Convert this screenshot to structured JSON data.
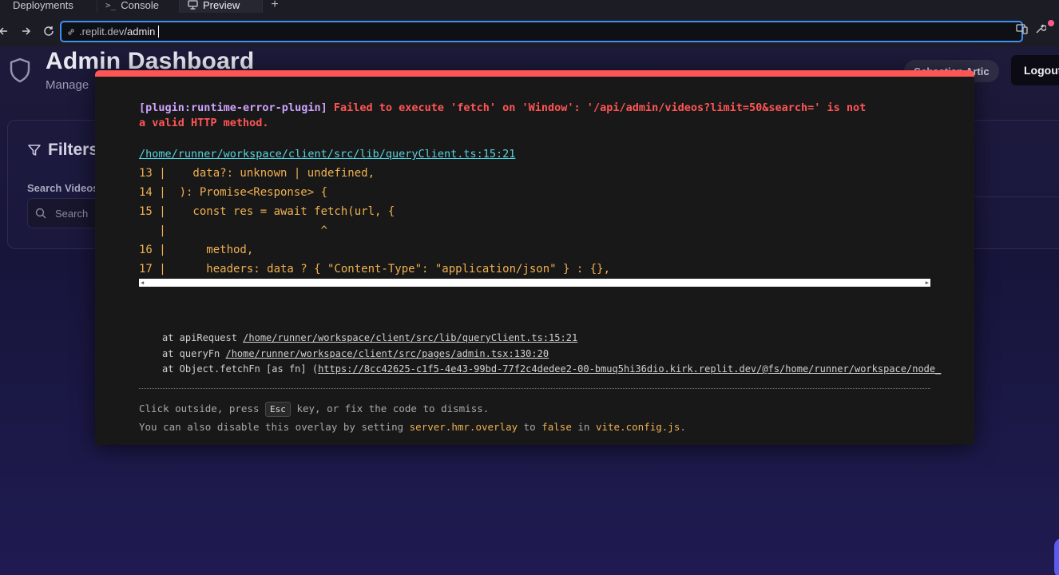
{
  "tabs": [
    {
      "label": "Deployments",
      "icon": "rocket-icon"
    },
    {
      "label": "Console",
      "icon_glyph": ">_"
    },
    {
      "label": "Preview",
      "icon": "monitor-icon"
    }
  ],
  "tab_add_label": "+",
  "url": {
    "host": ".replit.dev",
    "path": "/admin"
  },
  "page": {
    "title": "Admin Dashboard",
    "subtitle": "Manage",
    "user": "Sebastian Artic",
    "logout_label": "Logout",
    "filters_title": "Filters",
    "search_label": "Search Videos",
    "search_placeholder": "Search"
  },
  "error": {
    "plugin": "[plugin:runtime-error-plugin]",
    "message_line1": " Failed to execute 'fetch' on 'Window': '/api/admin/videos?limit=50&search=' is not",
    "message_line2": "a valid HTTP method.",
    "file": "/home/runner/workspace/client/src/lib/queryClient.ts:15:21",
    "code_lines": [
      "13 |    data?: unknown | undefined,",
      "14 |  ): Promise<Response> {",
      "15 |    const res = await fetch(url, {",
      "   |                       ^",
      "16 |      method,",
      "17 |      headers: data ? { \"Content-Type\": \"application/json\" } : {},"
    ],
    "stack": [
      {
        "prefix": "at apiRequest ",
        "link": "/home/runner/workspace/client/src/lib/queryClient.ts:15:21",
        "suffix": ""
      },
      {
        "prefix": "at queryFn ",
        "link": "/home/runner/workspace/client/src/pages/admin.tsx:130:20",
        "suffix": ""
      },
      {
        "prefix": "at Object.fetchFn [as fn] (",
        "link": "https://8cc42625-c1f5-4e43-99bd-77f2c4dedee2-00-bmuq5hi36dio.kirk.replit.dev/@fs/home/runner/workspace/node_",
        "suffix": ""
      }
    ],
    "tip_pre": "Click outside, press ",
    "tip_key": "Esc",
    "tip_post": " key, or fix the code to dismiss.",
    "tip2_pre": "You can also disable this overlay by setting ",
    "tip2_setting": "server.hmr.overlay",
    "tip2_mid": " to ",
    "tip2_value": "false",
    "tip2_in": " in ",
    "tip2_file": "vite.config.js",
    "tip2_end": "."
  },
  "colors": {
    "error_red": "#ff5555",
    "plugin_purple": "#cfa3ff",
    "code_yellow": "#f0b050",
    "link_cyan": "#56d4de",
    "url_focus": "#3f8ef5"
  }
}
